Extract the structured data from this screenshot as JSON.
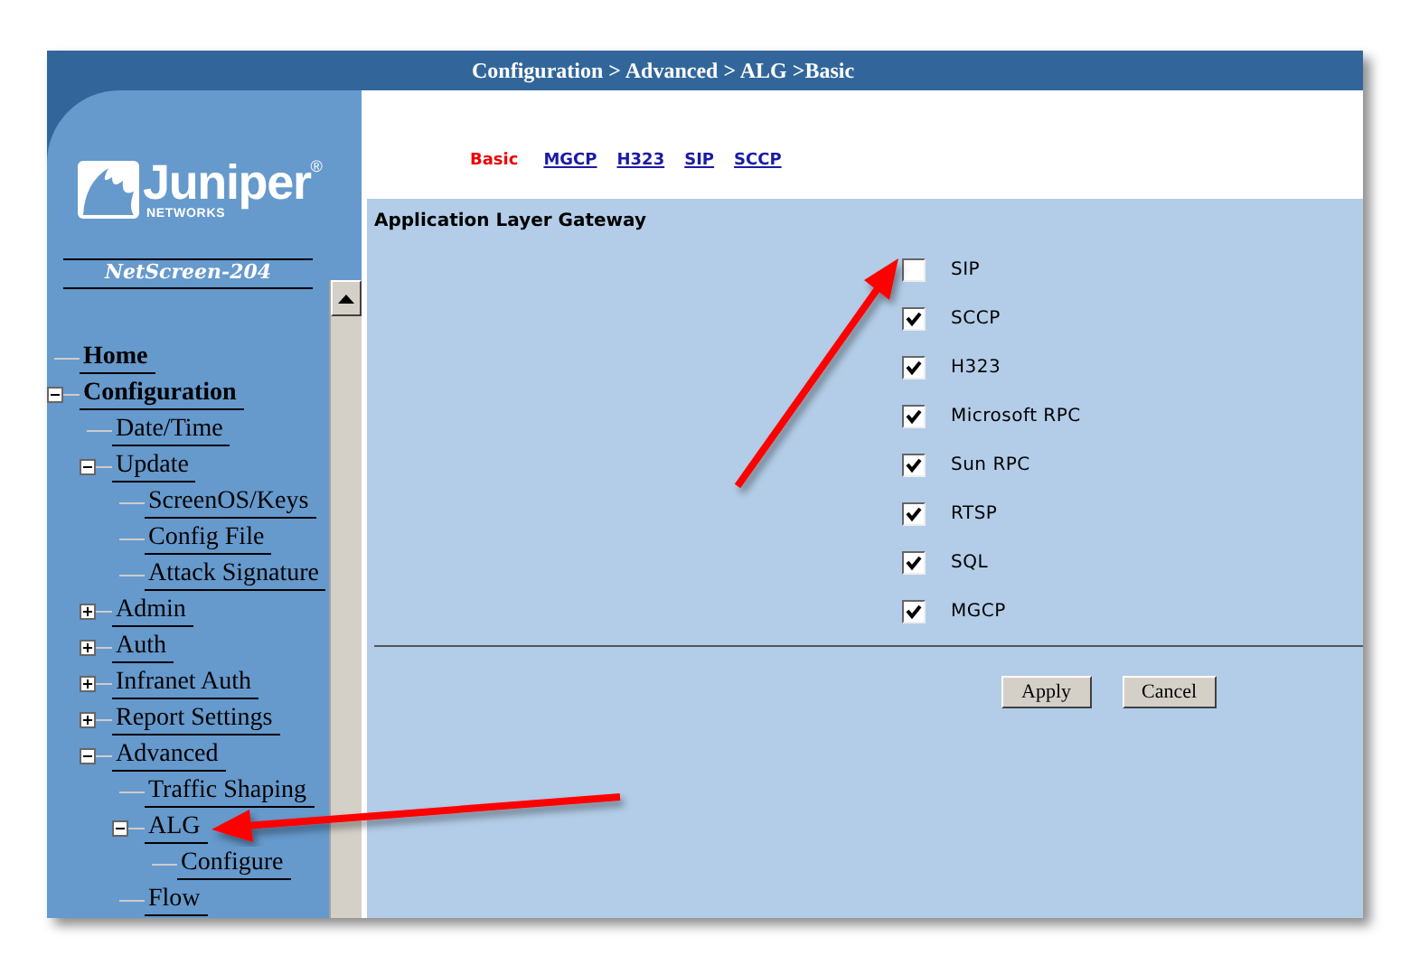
{
  "breadcrumb": "Configuration > Advanced > ALG >Basic",
  "logo": {
    "name": "Juniper",
    "mark": "®",
    "sub": "NETWORKS"
  },
  "device": "NetScreen-204",
  "tree": [
    {
      "label": "Home",
      "bold": true
    },
    {
      "label": "Configuration",
      "bold": true,
      "expanded": true,
      "children": [
        {
          "label": "Date/Time"
        },
        {
          "label": "Update",
          "expanded": true,
          "children": [
            {
              "label": "ScreenOS/Keys"
            },
            {
              "label": "Config File"
            },
            {
              "label": "Attack Signature"
            }
          ]
        },
        {
          "label": "Admin",
          "expanded": false
        },
        {
          "label": "Auth",
          "expanded": false
        },
        {
          "label": "Infranet Auth",
          "expanded": false
        },
        {
          "label": "Report Settings",
          "expanded": false
        },
        {
          "label": "Advanced",
          "expanded": true,
          "children": [
            {
              "label": "Traffic Shaping"
            },
            {
              "label": "ALG",
              "expanded": true,
              "children": [
                {
                  "label": "Configure"
                }
              ]
            },
            {
              "label": "Flow"
            }
          ]
        }
      ]
    }
  ],
  "tabs": [
    {
      "label": "Basic",
      "selected": true
    },
    {
      "label": "MGCP",
      "selected": false
    },
    {
      "label": "H323",
      "selected": false
    },
    {
      "label": "SIP",
      "selected": false
    },
    {
      "label": "SCCP",
      "selected": false
    }
  ],
  "panel_title": "Application Layer Gateway",
  "options": [
    {
      "label": "SIP",
      "checked": false
    },
    {
      "label": "SCCP",
      "checked": true
    },
    {
      "label": "H323",
      "checked": true
    },
    {
      "label": "Microsoft RPC",
      "checked": true
    },
    {
      "label": "Sun RPC",
      "checked": true
    },
    {
      "label": "RTSP",
      "checked": true
    },
    {
      "label": "SQL",
      "checked": true
    },
    {
      "label": "MGCP",
      "checked": true
    }
  ],
  "buttons": [
    "Apply",
    "Cancel"
  ]
}
